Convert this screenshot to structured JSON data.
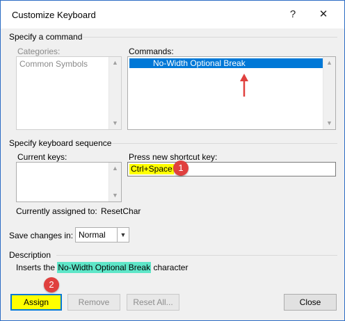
{
  "window": {
    "title": "Customize Keyboard",
    "help": "?",
    "close": "✕"
  },
  "specify_command": {
    "heading": "Specify a command",
    "categories_label": "Categories:",
    "categories_items": [
      "Common Symbols"
    ],
    "commands_label": "Commands:",
    "commands_items": [
      "No-Width Optional Break"
    ]
  },
  "keyboard_sequence": {
    "heading": "Specify keyboard sequence",
    "current_keys_label": "Current keys:",
    "new_key_label": "Press new shortcut key:",
    "new_key_value": "Ctrl+Space",
    "assigned_label": "Currently assigned to:",
    "assigned_value": "ResetChar"
  },
  "save_changes": {
    "label": "Save changes in:",
    "value": "Normal"
  },
  "description": {
    "heading": "Description",
    "prefix": "Inserts the",
    "highlight": "No-Width Optional Break",
    "suffix": "character"
  },
  "buttons": {
    "assign": "Assign",
    "remove": "Remove",
    "reset_all": "Reset All...",
    "close": "Close"
  },
  "annotations": {
    "badge1": "1",
    "badge2": "2"
  },
  "colors": {
    "accent": "#0078d7",
    "annotation_red": "#e0403e",
    "highlight_yellow": "#ffff00",
    "highlight_cyan": "#5ee6c8"
  }
}
